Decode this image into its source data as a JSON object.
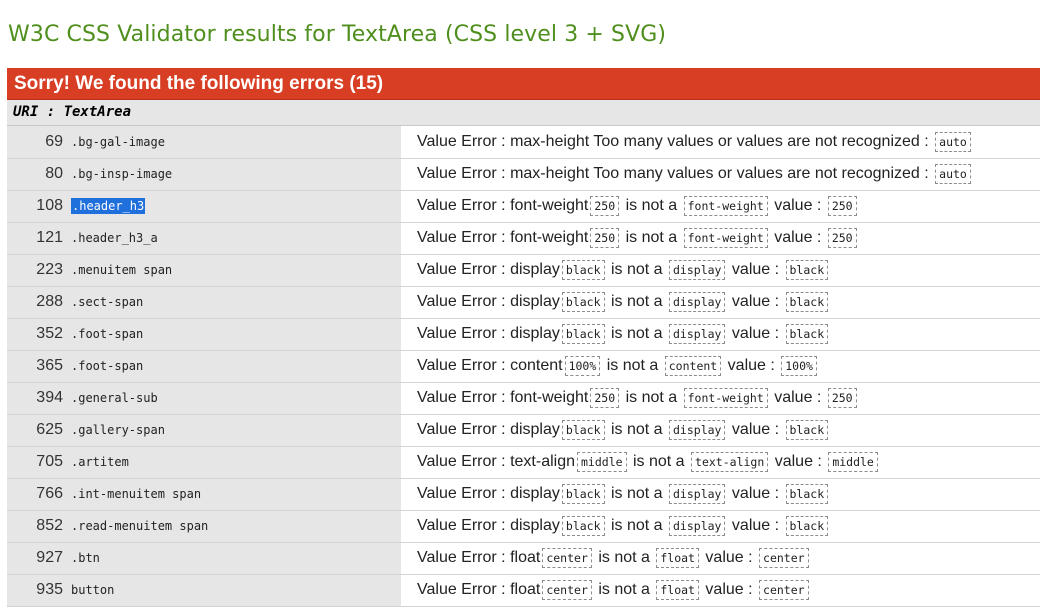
{
  "header": {
    "title": "W3C CSS Validator results for TextArea (CSS level 3 + SVG)"
  },
  "errors_section": {
    "banner": "Sorry! We found the following errors (15)",
    "uri_label": "URI : TextArea",
    "rows": [
      {
        "line": "69",
        "context": ".bg-gal-image",
        "type": "too_many",
        "prop": "max-height",
        "value": "auto",
        "prefix": "Value Error : ",
        "msg": " Too many values or values are not recognized : "
      },
      {
        "line": "80",
        "context": ".bg-insp-image",
        "type": "too_many",
        "prop": "max-height",
        "value": "auto",
        "prefix": "Value Error : ",
        "msg": " Too many values or values are not recognized : "
      },
      {
        "line": "108",
        "context": ".header_h3",
        "selected": true,
        "type": "not_a",
        "prop": "font-weight",
        "value": "250",
        "prefix": "Value Error : ",
        "is_not_a": " is not a ",
        "value_sep": " value : "
      },
      {
        "line": "121",
        "context": ".header_h3_a",
        "type": "not_a",
        "prop": "font-weight",
        "value": "250",
        "prefix": "Value Error : ",
        "is_not_a": " is not a ",
        "value_sep": " value : "
      },
      {
        "line": "223",
        "context": ".menuitem span",
        "type": "not_a",
        "prop": "display",
        "value": "black",
        "prefix": "Value Error : ",
        "is_not_a": " is not a ",
        "value_sep": " value : "
      },
      {
        "line": "288",
        "context": ".sect-span",
        "type": "not_a",
        "prop": "display",
        "value": "black",
        "prefix": "Value Error : ",
        "is_not_a": " is not a ",
        "value_sep": " value : "
      },
      {
        "line": "352",
        "context": ".foot-span",
        "type": "not_a",
        "prop": "display",
        "value": "black",
        "prefix": "Value Error : ",
        "is_not_a": " is not a ",
        "value_sep": " value : "
      },
      {
        "line": "365",
        "context": ".foot-span",
        "type": "not_a",
        "prop": "content",
        "value": "100%",
        "prefix": "Value Error : ",
        "is_not_a": " is not a ",
        "value_sep": " value : "
      },
      {
        "line": "394",
        "context": ".general-sub",
        "type": "not_a",
        "prop": "font-weight",
        "value": "250",
        "prefix": "Value Error : ",
        "is_not_a": " is not a ",
        "value_sep": " value : "
      },
      {
        "line": "625",
        "context": ".gallery-span",
        "type": "not_a",
        "prop": "display",
        "value": "black",
        "prefix": "Value Error : ",
        "is_not_a": " is not a ",
        "value_sep": " value : "
      },
      {
        "line": "705",
        "context": ".artitem",
        "type": "not_a",
        "prop": "text-align",
        "value": "middle",
        "prefix": "Value Error : ",
        "is_not_a": " is not a ",
        "value_sep": " value : "
      },
      {
        "line": "766",
        "context": ".int-menuitem span",
        "type": "not_a",
        "prop": "display",
        "value": "black",
        "prefix": "Value Error : ",
        "is_not_a": " is not a ",
        "value_sep": " value : "
      },
      {
        "line": "852",
        "context": ".read-menuitem span",
        "type": "not_a",
        "prop": "display",
        "value": "black",
        "prefix": "Value Error : ",
        "is_not_a": " is not a ",
        "value_sep": " value : "
      },
      {
        "line": "927",
        "context": ".btn",
        "type": "not_a",
        "prop": "float",
        "value": "center",
        "prefix": "Value Error : ",
        "is_not_a": " is not a ",
        "value_sep": " value : "
      },
      {
        "line": "935",
        "context": "button",
        "type": "not_a",
        "prop": "float",
        "value": "center",
        "prefix": "Value Error : ",
        "is_not_a": " is not a ",
        "value_sep": " value : "
      }
    ]
  },
  "colors": {
    "title_green": "#4f8f1e",
    "banner_red": "#d73e24",
    "gutter_gray": "#e6e6e6",
    "selection_blue": "#1f6fdd"
  }
}
